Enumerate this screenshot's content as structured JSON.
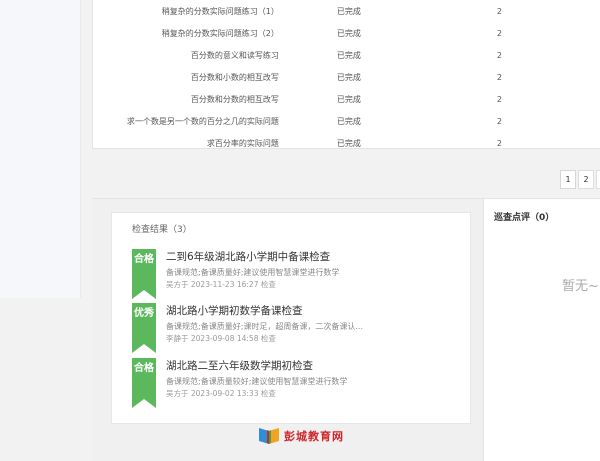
{
  "lessons": [
    {
      "name": "稍复杂的分数实际问题练习（1）",
      "status": "已完成",
      "count": "2"
    },
    {
      "name": "稍复杂的分数实际问题练习（2）",
      "status": "已完成",
      "count": "2"
    },
    {
      "name": "百分数的意义和读写练习",
      "status": "已完成",
      "count": "2"
    },
    {
      "name": "百分数和小数的相互改写",
      "status": "已完成",
      "count": "2"
    },
    {
      "name": "百分数和分数的相互改写",
      "status": "已完成",
      "count": "2"
    },
    {
      "name": "求一个数是另一个数的百分之几的实际问题",
      "status": "已完成",
      "count": "2"
    },
    {
      "name": "求百分率的实际问题",
      "status": "已完成",
      "count": "2"
    }
  ],
  "pagination": {
    "pages": [
      "1",
      "2"
    ],
    "current": "1"
  },
  "inspection": {
    "title": "检查结果（3）",
    "items": [
      {
        "grade": "合格",
        "title": "二到6年级湖北路小学期中备课检查",
        "desc": "备课规范;备课质量好;建议使用智慧课堂进行数学",
        "meta": "吴方于 2023-11-23 16:27 检查",
        "color": "#5cb85c"
      },
      {
        "grade": "优秀",
        "title": "湖北路小学期初数学备课检查",
        "desc": "备课规范;备课质量好;课时足，超周备课，二次备课认...",
        "meta": "李静于 2023-09-08 14:58 检查",
        "color": "#5cb85c"
      },
      {
        "grade": "合格",
        "title": "湖北路二至六年级数学期初检查",
        "desc": "备课规范;备课质量较好;建议使用智慧课堂进行数学",
        "meta": "吴方于 2023-09-02 13:33 检查",
        "color": "#5cb85c"
      }
    ]
  },
  "review": {
    "title": "巡查点评（0）",
    "empty_text": "暂无~"
  },
  "footer": {
    "logo_text": "彭城教育网",
    "logo_icon": "book-logo-icon"
  }
}
